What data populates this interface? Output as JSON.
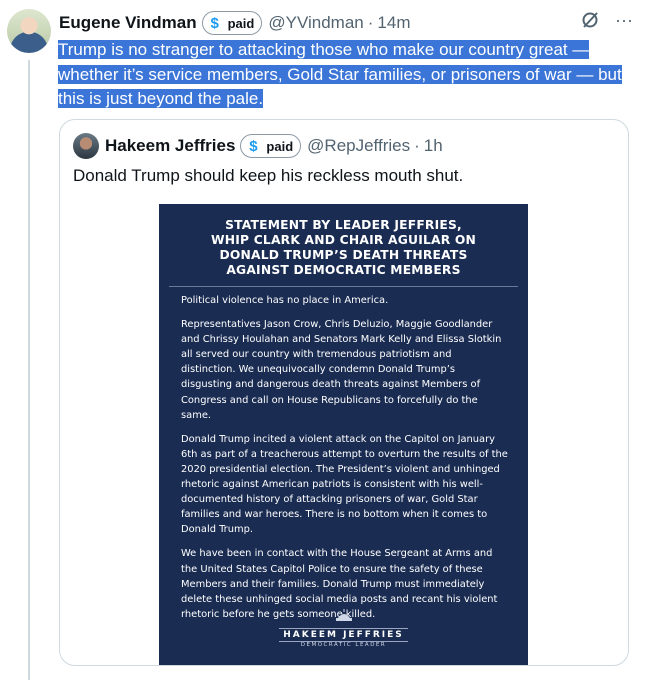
{
  "tweet": {
    "author_name": "Eugene Vindman",
    "badge": "paid",
    "handle": "@YVindman",
    "separator": "·",
    "time": "14m",
    "more": "···",
    "lines": [
      "Trump is no stranger to attacking those who make our country great —",
      "whether it’s service members, Gold Star families, or prisoners of war — but",
      "this is just beyond the pale."
    ]
  },
  "quoted": {
    "author_name": "Hakeem Jeffries",
    "badge": "paid",
    "handle": "@RepJeffries",
    "separator": "·",
    "time": "1h",
    "text": "Donald Trump should keep his reckless mouth shut.",
    "statement": {
      "title_lines": [
        "STATEMENT BY LEADER JEFFRIES,",
        "WHIP CLARK AND CHAIR AGUILAR ON",
        "DONALD TRUMP’S DEATH THREATS",
        "AGAINST DEMOCRATIC MEMBERS"
      ],
      "paragraphs": [
        "Political violence has no place in America.",
        "Representatives Jason Crow, Chris Deluzio, Maggie Goodlander and Chrissy Houlahan and Senators Mark Kelly and Elissa Slotkin all served our country with tremendous patriotism and distinction. We unequivocally condemn Donald Trump’s disgusting and dangerous death threats against Members of Congress and call on House Republicans to forcefully do the same.",
        "Donald Trump incited a violent attack on the Capitol on January 6th as part of a treacherous attempt to overturn the results of the 2020 presidential election. The President’s violent and unhinged rhetoric against American patriots is consistent with his well-documented history of attacking prisoners of war, Gold Star families and war heroes. There is no bottom when it comes to Donald Trump.",
        "We have been in contact with the House Sergeant at Arms and the United States Capitol Police to ensure the safety of these Members and their families. Donald Trump must immediately delete these unhinged social media posts and recant his violent rhetoric before he gets someone killed."
      ],
      "logo_name": "HAKEEM JEFFRIES",
      "logo_sub": "DEMOCRATIC LEADER"
    }
  },
  "icons": {
    "paid_badge": "dollar-icon",
    "grok": "grok-icon",
    "more": "more-icon"
  },
  "colors": {
    "highlight": "#3a75d7",
    "accent": "#1d9bf0",
    "statement_bg": "#1a2c52",
    "secondary_text": "#536471"
  }
}
